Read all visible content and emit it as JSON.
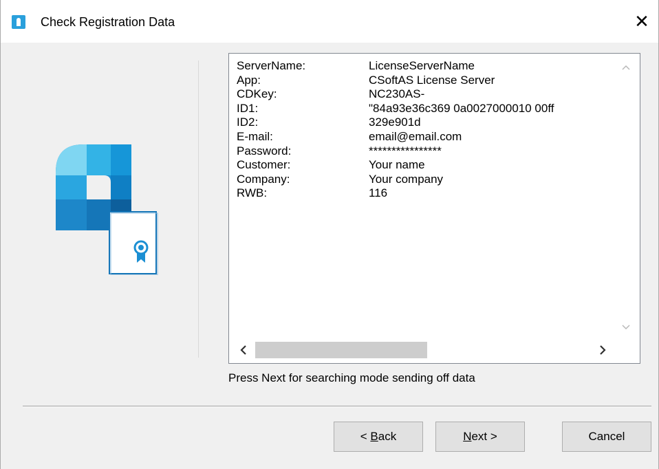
{
  "window": {
    "title": "Check Registration Data",
    "close_glyph": "✕"
  },
  "registration": {
    "rows": [
      {
        "key": "ServerName:",
        "value": "LicenseServerName"
      },
      {
        "key": "App:",
        "value": "CSoftAS License Server"
      },
      {
        "key": "CDKey:",
        "value": "NC230AS-"
      },
      {
        "key": "ID1:",
        "value": "\"84a93e36c369 0a0027000010 00ff"
      },
      {
        "key": "ID2:",
        "value": "329e901d"
      },
      {
        "key": "E-mail:",
        "value": "email@email.com"
      },
      {
        "key": "Password:",
        "value": "****************"
      },
      {
        "key": "Customer:",
        "value": "Your name"
      },
      {
        "key": "Company:",
        "value": "Your company"
      },
      {
        "key": "RWB:",
        "value": "116"
      }
    ]
  },
  "scrollbars": {
    "up": "^",
    "down": "v",
    "left": "<",
    "right": ">"
  },
  "hint": "Press Next for searching mode sending off data",
  "buttons": {
    "back_mark": "< ",
    "back_accel": "B",
    "back_rest": "ack",
    "next_accel": "N",
    "next_rest": "ext >",
    "cancel": "Cancel"
  },
  "icons": {
    "title_icon": "license-app-icon",
    "logo": "license-server-logo",
    "certificate": "certificate-ribbon-icon"
  },
  "colors": {
    "window_bg": "#f0f0f0",
    "title_bg": "#ffffff",
    "accent": "#1e8fd4",
    "button_bg": "#e1e1e1"
  }
}
